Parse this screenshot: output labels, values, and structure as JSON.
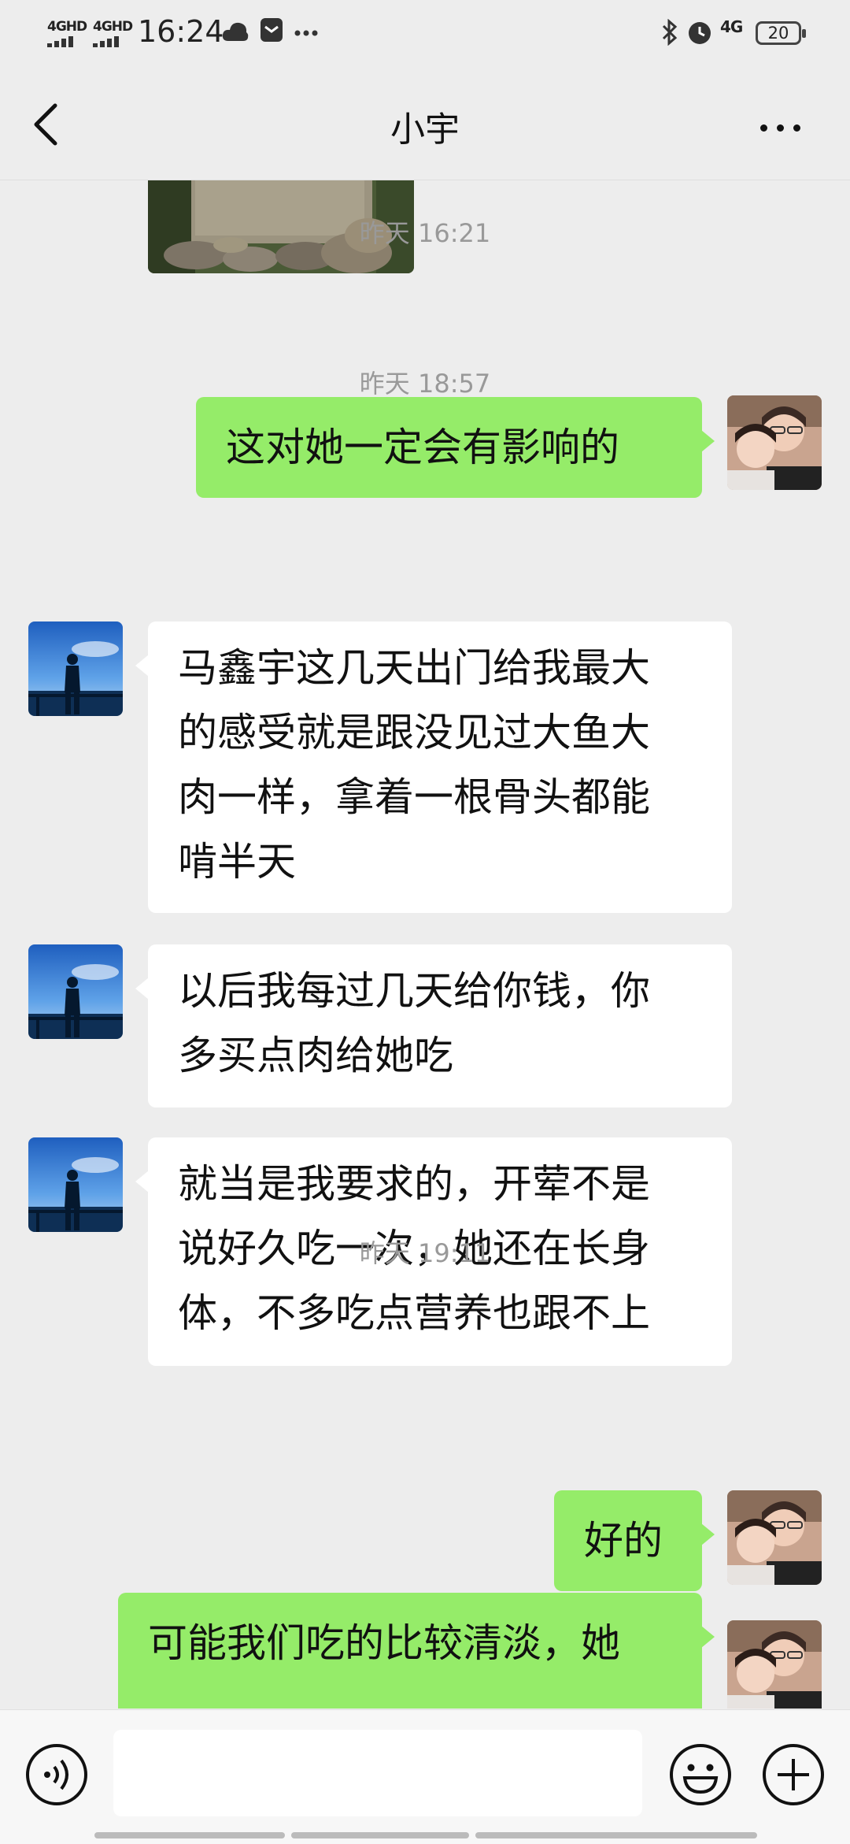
{
  "status_bar": {
    "signal1": "4GHD",
    "signal2": "4GHD",
    "time": "16:24",
    "network": "4G",
    "battery": "20"
  },
  "header": {
    "title": "小宇"
  },
  "messages": [
    {
      "type": "timestamp",
      "text": "昨天 16:21"
    },
    {
      "type": "sent",
      "text": "这对她一定会有影响的"
    },
    {
      "type": "timestamp",
      "text": "昨天 18:57"
    },
    {
      "type": "received",
      "lines": [
        "马鑫宇这几天出门给我最大",
        "的感受就是跟没见过大鱼大",
        "肉一样，拿着一根骨头都能",
        "啃半天"
      ]
    },
    {
      "type": "received",
      "lines": [
        "以后我每过几天给你钱，你",
        "多买点肉给她吃"
      ]
    },
    {
      "type": "received",
      "lines": [
        "就当是我要求的，开荤不是",
        "说好久吃一次，她还在长身",
        "体，不多吃点营养也跟不上"
      ]
    },
    {
      "type": "timestamp",
      "text": "昨天 19:11"
    },
    {
      "type": "sent",
      "text": "好的"
    },
    {
      "type": "sent",
      "text": "可能我们吃的比较清淡，她"
    }
  ],
  "input": {
    "placeholder": ""
  },
  "colors": {
    "sent_bubble": "#95ec69",
    "received_bubble": "#ffffff",
    "background": "#ededed"
  }
}
